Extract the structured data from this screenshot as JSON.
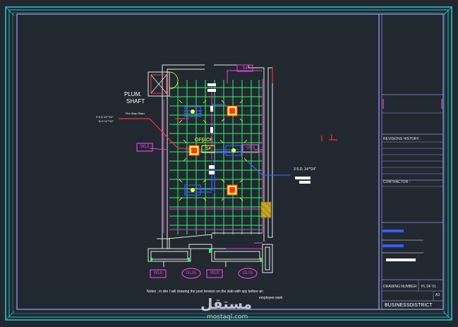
{
  "drawing": {
    "labels": {
      "plum_shaft_line1": "PLUM.",
      "plum_shaft_line2": "SHAFT",
      "spec_left_1": "3 S.D 24\"*24\"",
      "spec_left_2": "B.D 12\"*12\"",
      "fire_feed": "Fire Main Riser",
      "office_label": "OFFICE",
      "spec_right": "3 S.D. 24\"*24\"",
      "note_line1": "Notes ; in site I will drawing the post tension on the slab with spy before an",
      "note_line2": "employee work"
    },
    "tags": {
      "wl3_left": "WL3",
      "wl3_right": "WL3",
      "wl8_left": "WL8",
      "wl8_right": "WL8",
      "gl05_left": "GL05",
      "gl05_right": "GL05",
      "s4_top": "S4",
      "s4_mid": "S4"
    }
  },
  "title_block": {
    "revisions_history": "REVISIONS HISTORY :",
    "contractor": "CONTRACTOR :",
    "drawing_number_label": "DRAWING NUMBER:",
    "drawing_number_value": "PL DF 01",
    "sheet_size": "A3",
    "project": "BUSINESSDISTRICT"
  },
  "watermark": {
    "arabic": "مستقل",
    "latin": "mostaql.com"
  },
  "colors": {
    "background": "#212830",
    "border": "#23c3c9",
    "frame": "#8f8fe0",
    "grid": "#2cf56a",
    "wall": "#e8e8e8",
    "magenta": "#e83fd8",
    "red": "#ff3030",
    "blue": "#3b5bff",
    "yellow": "#ffff33"
  }
}
